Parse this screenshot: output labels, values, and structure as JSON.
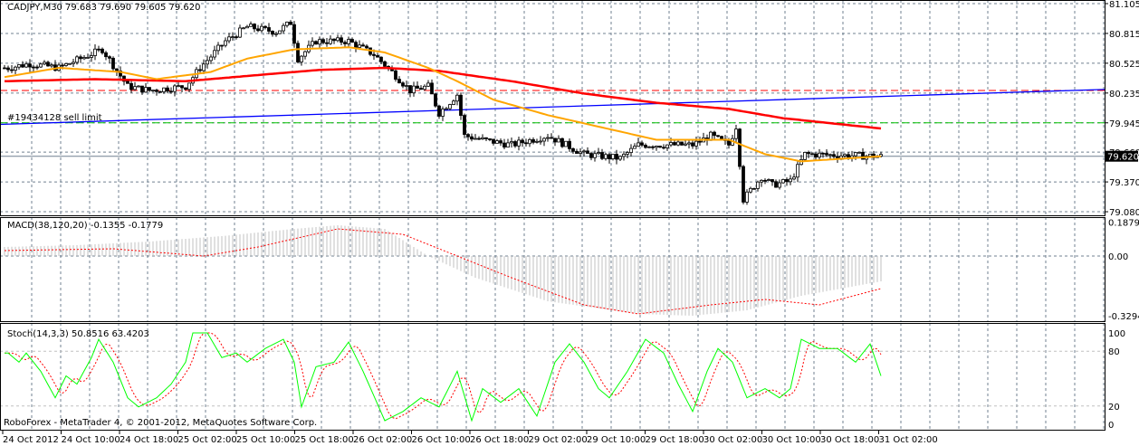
{
  "window": {
    "symbol_label": "CADJPY,M30",
    "ohlc": "79.683 79.690 79.605 79.620",
    "order_label": "#19434128 sell limit",
    "copyright": "RoboForex - MetaTrader 4, © 2001-2012, MetaQuotes Software Corp."
  },
  "colors": {
    "bull_body": "#ffffff",
    "bear_body": "#000000",
    "ma_fast": "#ffa500",
    "ma_slow": "#ff0000",
    "trendline": "#0000ff",
    "sell_limit": "#00c000",
    "grid": "#708090",
    "macd_hist": "#c0c0c0",
    "macd_signal": "#ff0000",
    "stoch_main": "#00ff00",
    "stoch_signal": "#ff0000"
  },
  "chart_data": [
    {
      "type": "candlestick",
      "name": "CADJPY M30",
      "price_scale_labels": [
        "81.105",
        "80.815",
        "80.525",
        "80.235",
        "79.945",
        "79.660",
        "79.370",
        "79.080"
      ],
      "price_scale_values": [
        81.105,
        80.815,
        80.525,
        80.235,
        79.945,
        79.66,
        79.37,
        79.08
      ],
      "ylim": [
        79.08,
        81.105
      ],
      "bid_price": 79.62,
      "bid_label": "79.620",
      "sell_limit_price": 79.945,
      "dashed_level": 80.26,
      "trendline": [
        [
          0,
          79.93
        ],
        [
          305,
          80.27
        ]
      ],
      "close_path": [
        [
          1,
          80.48
        ],
        [
          7,
          80.52
        ],
        [
          15,
          80.48
        ],
        [
          27,
          80.66
        ],
        [
          34,
          80.3
        ],
        [
          40,
          80.26
        ],
        [
          50,
          80.3
        ],
        [
          54,
          80.48
        ],
        [
          61,
          80.74
        ],
        [
          67,
          80.88
        ],
        [
          75,
          80.83
        ],
        [
          79,
          80.92
        ],
        [
          81,
          80.57
        ],
        [
          86,
          80.74
        ],
        [
          95,
          80.74
        ],
        [
          102,
          80.61
        ],
        [
          107,
          80.44
        ],
        [
          112,
          80.26
        ],
        [
          117,
          80.3
        ],
        [
          120,
          80.04
        ],
        [
          125,
          80.22
        ],
        [
          127,
          79.82
        ],
        [
          132,
          79.78
        ],
        [
          140,
          79.73
        ],
        [
          150,
          79.82
        ],
        [
          160,
          79.64
        ],
        [
          170,
          79.6
        ],
        [
          175,
          79.73
        ],
        [
          190,
          79.73
        ],
        [
          195,
          79.82
        ],
        [
          200,
          79.73
        ],
        [
          202,
          79.91
        ],
        [
          204,
          79.2
        ],
        [
          209,
          79.42
        ],
        [
          212,
          79.34
        ],
        [
          217,
          79.38
        ],
        [
          221,
          79.64
        ],
        [
          230,
          79.63
        ],
        [
          242,
          79.62
        ]
      ],
      "ma_fast": [
        [
          0,
          80.39
        ],
        [
          15,
          80.48
        ],
        [
          32,
          80.44
        ],
        [
          42,
          80.37
        ],
        [
          57,
          80.44
        ],
        [
          67,
          80.57
        ],
        [
          80,
          80.66
        ],
        [
          95,
          80.68
        ],
        [
          105,
          80.63
        ],
        [
          117,
          80.48
        ],
        [
          125,
          80.35
        ],
        [
          135,
          80.17
        ],
        [
          150,
          80.02
        ],
        [
          170,
          79.86
        ],
        [
          180,
          79.78
        ],
        [
          200,
          79.78
        ],
        [
          210,
          79.64
        ],
        [
          220,
          79.57
        ],
        [
          242,
          79.62
        ]
      ],
      "ma_slow": [
        [
          0,
          80.35
        ],
        [
          25,
          80.37
        ],
        [
          50,
          80.35
        ],
        [
          70,
          80.41
        ],
        [
          87,
          80.46
        ],
        [
          105,
          80.48
        ],
        [
          120,
          80.45
        ],
        [
          140,
          80.35
        ],
        [
          160,
          80.23
        ],
        [
          180,
          80.14
        ],
        [
          200,
          80.08
        ],
        [
          215,
          79.99
        ],
        [
          242,
          79.89
        ]
      ]
    },
    {
      "type": "bar",
      "name": "MACD",
      "label": "MACD(38,120,20) -0.1355 -0.1779",
      "scale_labels": [
        "0.1879",
        "0.00",
        "-0.3294"
      ],
      "scale_values": [
        0.1879,
        0.0,
        -0.3294
      ],
      "histogram": [
        [
          0,
          0.05
        ],
        [
          20,
          0.06
        ],
        [
          40,
          0.08
        ],
        [
          60,
          0.11
        ],
        [
          80,
          0.15
        ],
        [
          92,
          0.17
        ],
        [
          105,
          0.15
        ],
        [
          117,
          0.0
        ],
        [
          130,
          -0.12
        ],
        [
          150,
          -0.25
        ],
        [
          175,
          -0.32
        ],
        [
          190,
          -0.33
        ],
        [
          205,
          -0.3
        ],
        [
          220,
          -0.22
        ],
        [
          242,
          -0.14
        ]
      ],
      "signal": [
        [
          0,
          0.03
        ],
        [
          30,
          0.04
        ],
        [
          55,
          0.0
        ],
        [
          70,
          0.05
        ],
        [
          92,
          0.15
        ],
        [
          110,
          0.12
        ],
        [
          125,
          0.0
        ],
        [
          140,
          -0.12
        ],
        [
          160,
          -0.27
        ],
        [
          175,
          -0.32
        ],
        [
          195,
          -0.27
        ],
        [
          210,
          -0.24
        ],
        [
          225,
          -0.27
        ],
        [
          242,
          -0.18
        ]
      ]
    },
    {
      "type": "line",
      "name": "Stochastic",
      "label": "Stoch(14,3,3) 50.8516 63.4203",
      "scale_labels": [
        "100",
        "80",
        "20",
        "0"
      ],
      "scale_values": [
        100,
        80,
        20,
        0
      ],
      "main": [
        [
          1,
          78
        ],
        [
          4,
          68
        ],
        [
          6,
          78
        ],
        [
          10,
          58
        ],
        [
          14,
          29
        ],
        [
          17,
          53
        ],
        [
          20,
          44
        ],
        [
          24,
          73
        ],
        [
          26,
          93
        ],
        [
          30,
          68
        ],
        [
          34,
          29
        ],
        [
          37,
          19
        ],
        [
          42,
          29
        ],
        [
          46,
          44
        ],
        [
          50,
          68
        ],
        [
          52,
          100
        ],
        [
          56,
          100
        ],
        [
          60,
          73
        ],
        [
          64,
          78
        ],
        [
          67,
          68
        ],
        [
          72,
          83
        ],
        [
          77,
          93
        ],
        [
          80,
          68
        ],
        [
          82,
          19
        ],
        [
          86,
          63
        ],
        [
          91,
          68
        ],
        [
          95,
          90
        ],
        [
          99,
          58
        ],
        [
          105,
          4
        ],
        [
          110,
          14
        ],
        [
          115,
          29
        ],
        [
          120,
          19
        ],
        [
          125,
          58
        ],
        [
          129,
          4
        ],
        [
          132,
          39
        ],
        [
          137,
          24
        ],
        [
          142,
          39
        ],
        [
          147,
          9
        ],
        [
          152,
          68
        ],
        [
          156,
          88
        ],
        [
          160,
          68
        ],
        [
          164,
          39
        ],
        [
          167,
          29
        ],
        [
          172,
          58
        ],
        [
          177,
          93
        ],
        [
          182,
          78
        ],
        [
          186,
          44
        ],
        [
          190,
          14
        ],
        [
          194,
          58
        ],
        [
          197,
          83
        ],
        [
          201,
          68
        ],
        [
          205,
          29
        ],
        [
          210,
          39
        ],
        [
          214,
          29
        ],
        [
          217,
          39
        ],
        [
          220,
          93
        ],
        [
          225,
          83
        ],
        [
          230,
          83
        ],
        [
          235,
          68
        ],
        [
          239,
          88
        ],
        [
          242,
          53
        ]
      ]
    }
  ],
  "time_axis": {
    "labels": [
      "24 Oct 2012",
      "24 Oct 10:00",
      "24 Oct 18:00",
      "25 Oct 02:00",
      "25 Oct 10:00",
      "25 Oct 18:00",
      "26 Oct 02:00",
      "26 Oct 10:00",
      "26 Oct 18:00",
      "29 Oct 02:00",
      "29 Oct 10:00",
      "29 Oct 18:00",
      "30 Oct 02:00",
      "30 Oct 10:00",
      "30 Oct 18:00",
      "31 Oct 02:00"
    ]
  }
}
